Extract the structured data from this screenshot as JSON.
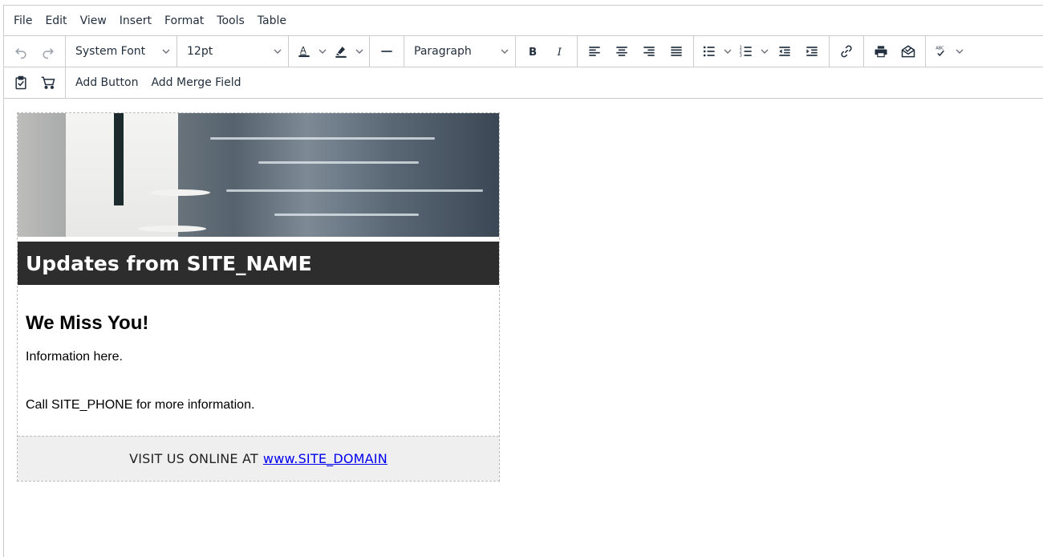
{
  "menubar": {
    "items": [
      "File",
      "Edit",
      "View",
      "Insert",
      "Format",
      "Tools",
      "Table"
    ]
  },
  "toolbar": {
    "font_family": "System Font",
    "font_size": "12pt",
    "block_format": "Paragraph"
  },
  "toolbar2": {
    "add_button": "Add Button",
    "add_merge_field": "Add Merge Field"
  },
  "email": {
    "banner_title": "Updates from SITE_NAME",
    "heading": "We Miss You!",
    "info": "Information here.",
    "call": "Call SITE_PHONE for more information.",
    "footer_prefix": "VISIT US ONLINE AT",
    "footer_link": "www.SITE_DOMAIN"
  },
  "colors": {
    "banner_bg": "#2d2d2d",
    "footer_bg": "#efefef",
    "link": "#0000ee",
    "text_color_swatch": "#222f3e"
  }
}
